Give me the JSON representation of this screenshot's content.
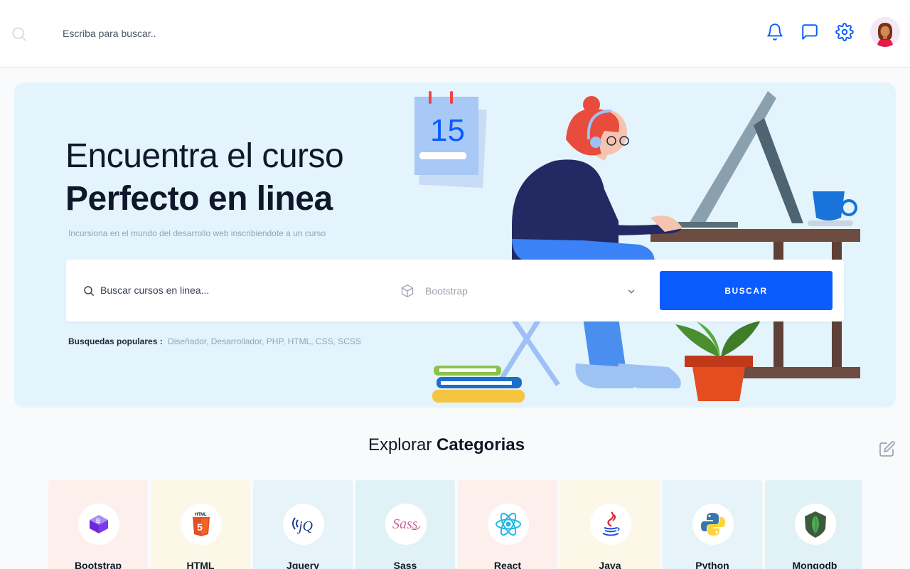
{
  "topbar": {
    "search_placeholder": "Escriba para buscar..",
    "icons": [
      "search-icon",
      "bell-icon",
      "chat-icon",
      "gear-icon",
      "avatar"
    ],
    "accent": "#0a5cff"
  },
  "hero": {
    "title_light": "Encuentra el curso",
    "title_bold": "Perfecto en linea",
    "subtitle": "Incursiona en el mundo del desarrollo web inscribiendote a un curso",
    "background": "#e3f4fd",
    "calendar_day": "15",
    "search": {
      "placeholder": "Buscar cursos en linea...",
      "select_value": "Bootstrap",
      "button_label": "BUSCAR"
    },
    "popular": {
      "label": "Busquedas populares :",
      "tags": "Diseñador, Desarrollador, PHP, HTML, CSS, SCSS"
    }
  },
  "categories": {
    "title_light": "Explorar",
    "title_bold": "Categorias",
    "items": [
      {
        "label": "Bootstrap",
        "bg": "#fdf0ec",
        "icon": "bootstrap-icon"
      },
      {
        "label": "HTML",
        "bg": "#fdf7e8",
        "icon": "html5-icon"
      },
      {
        "label": "Jquery",
        "bg": "#e6f3f8",
        "icon": "jquery-icon"
      },
      {
        "label": "Sass",
        "bg": "#e0f2f5",
        "icon": "sass-icon"
      },
      {
        "label": "React",
        "bg": "#fdf0ec",
        "icon": "react-icon"
      },
      {
        "label": "Java",
        "bg": "#fdf7e8",
        "icon": "java-icon"
      },
      {
        "label": "Python",
        "bg": "#e6f3f8",
        "icon": "python-icon"
      },
      {
        "label": "Mongodb",
        "bg": "#e0f2f5",
        "icon": "mongodb-icon"
      }
    ]
  }
}
